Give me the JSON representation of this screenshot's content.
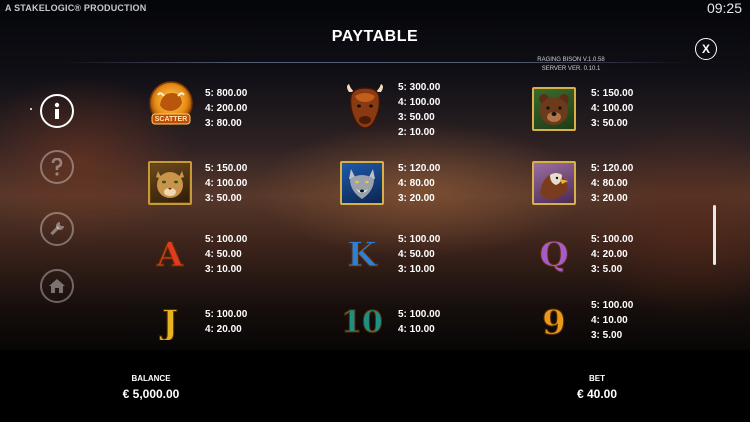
{
  "header": {
    "studio": "A STAKELOGIC® PRODUCTION",
    "clock": "09:25",
    "title": "PAYTABLE",
    "version_line1": "RAGING BISON V.1.0.58",
    "version_line2": "SERVER VER. 0.10.1",
    "close_label": "X"
  },
  "sidebar": {
    "buttons": [
      {
        "icon": "info-icon",
        "state": "active"
      },
      {
        "icon": "question-icon",
        "state": "inactive"
      },
      {
        "icon": "wrench-icon",
        "state": "inactive"
      },
      {
        "icon": "home-icon",
        "state": "inactive"
      }
    ]
  },
  "symbols": [
    {
      "id": "scatter",
      "label": "SCATTER",
      "pays": [
        "5: 800.00",
        "4: 200.00",
        "3: 80.00"
      ]
    },
    {
      "id": "bison",
      "pays": [
        "5: 300.00",
        "4: 100.00",
        "3: 50.00",
        "2: 10.00"
      ]
    },
    {
      "id": "bear",
      "pays": [
        "5: 150.00",
        "4: 100.00",
        "3: 50.00"
      ]
    },
    {
      "id": "cougar",
      "pays": [
        "5: 150.00",
        "4: 100.00",
        "3: 50.00"
      ]
    },
    {
      "id": "wolf",
      "pays": [
        "5: 120.00",
        "4: 80.00",
        "3: 20.00"
      ]
    },
    {
      "id": "eagle",
      "pays": [
        "5: 120.00",
        "4: 80.00",
        "3: 20.00"
      ]
    },
    {
      "id": "A",
      "label": "A",
      "pays": [
        "5: 100.00",
        "4: 50.00",
        "3: 10.00"
      ]
    },
    {
      "id": "K",
      "label": "K",
      "pays": [
        "5: 100.00",
        "4: 50.00",
        "3: 10.00"
      ]
    },
    {
      "id": "Q",
      "label": "Q",
      "pays": [
        "5: 100.00",
        "4: 20.00",
        "3: 5.00"
      ]
    },
    {
      "id": "J",
      "label": "J",
      "pays": [
        "5: 100.00",
        "4: 20.00"
      ]
    },
    {
      "id": "10",
      "label": "10",
      "pays": [
        "5: 100.00",
        "4: 10.00"
      ]
    },
    {
      "id": "9",
      "label": "9",
      "pays": [
        "5: 100.00",
        "4: 10.00",
        "3: 5.00"
      ]
    }
  ],
  "footer": {
    "balance_label": "BALANCE",
    "balance_value": "€ 5,000.00",
    "bet_label": "BET",
    "bet_value": "€ 40.00"
  },
  "colors": {
    "gold": "#f0b429",
    "letter_A": "#e23b1f",
    "letter_K": "#2f7fd8",
    "letter_Q": "#a55cc8",
    "letter_J": "#e7b320",
    "letter_10": "#1f8f84",
    "letter_9": "#e79a1c"
  }
}
